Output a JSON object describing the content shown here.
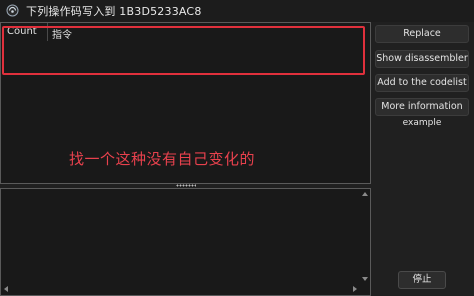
{
  "window": {
    "title": "下列操作码写入到 1B3D5233AC8",
    "app_icon": "cheat-engine-icon"
  },
  "list": {
    "columns": [
      "Count",
      "指令"
    ],
    "rows": [],
    "annotation_text": "找一个这种没有自己变化的",
    "highlight_color": "#e0303c"
  },
  "sidebar": {
    "replace_label": "Replace",
    "disassembler_label": "Show disassembler",
    "codelist_label": "Add to the codelist",
    "moreinfo_label": "More information",
    "example_label": "example",
    "stop_label": "停止"
  },
  "theme": {
    "background": "#202020",
    "panel": "#191919",
    "annotation_color": "#e8414d"
  }
}
